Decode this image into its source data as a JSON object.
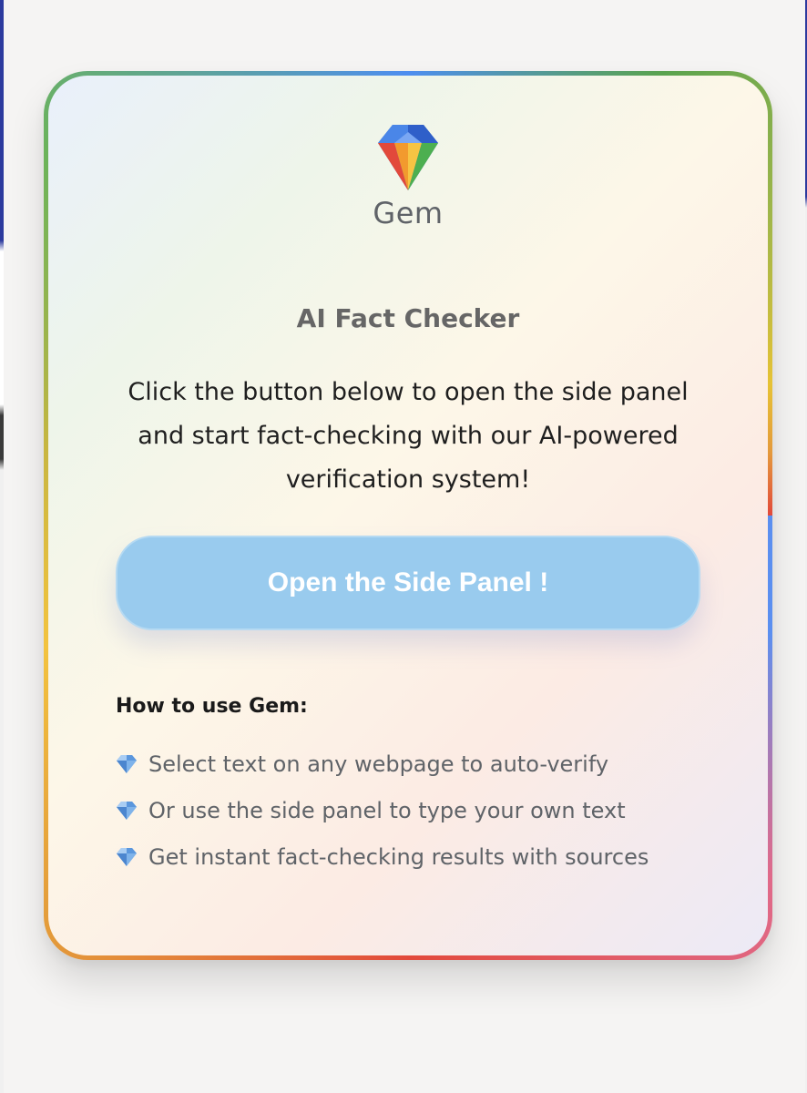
{
  "logo": {
    "name": "Gem",
    "icon": "gem-diamond-icon"
  },
  "title": "AI Fact Checker",
  "intro": "Click the button below to open the side panel and start fact-checking with our AI-powered verification system!",
  "open_button": {
    "label": "Open the Side Panel !"
  },
  "howto": {
    "title": "How to use Gem:",
    "items": [
      {
        "icon": "gem-icon",
        "text": "Select text on any webpage to auto-verify"
      },
      {
        "icon": "gem-icon",
        "text": "Or use the side panel to type your own text"
      },
      {
        "icon": "gem-icon",
        "text": "Get instant fact-checking results with sources"
      }
    ]
  },
  "colors": {
    "button_bg": "#99cbee",
    "title": "#666666",
    "body_text": "#1f1f1f",
    "list_text": "#5f6368",
    "border_blue": "#5b8ff0",
    "border_red": "#e2493b",
    "border_yellow": "#f3c33e",
    "border_green": "#6bb35a"
  }
}
